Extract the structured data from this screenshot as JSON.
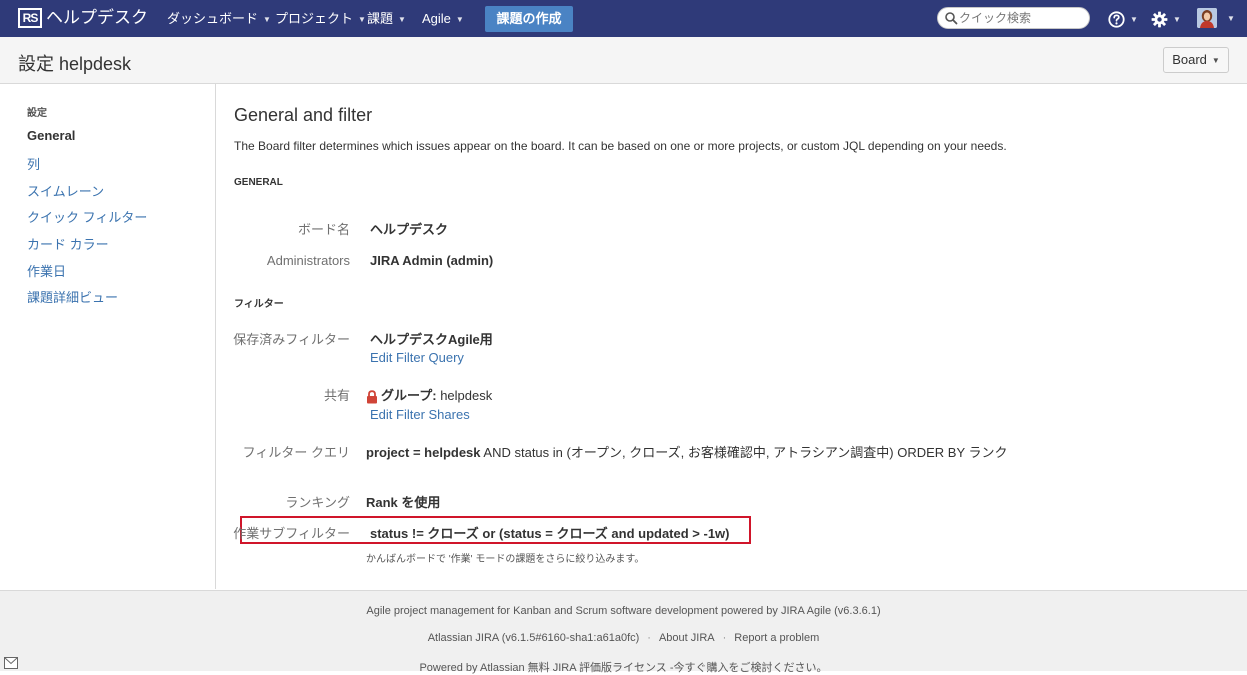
{
  "topnav": {
    "logo_mark": "RS",
    "app_name": "ヘルプデスク",
    "menus": [
      "ダッシュボード",
      "プロジェクト",
      "課題",
      "Agile"
    ],
    "create_label": "課題の作成",
    "search_placeholder": "クイック検索",
    "icons": [
      "help-icon",
      "gear-icon",
      "avatar"
    ]
  },
  "header": {
    "title": "設定 helpdesk",
    "board_button": "Board"
  },
  "sidebar": {
    "heading": "設定",
    "items": [
      "General",
      "列",
      "スイムレーン",
      "クイック フィルター",
      "カード カラー",
      "作業日",
      "課題詳細ビュー"
    ],
    "active_index": 0
  },
  "main": {
    "title": "General and filter",
    "description": "The Board filter determines which issues appear on the board. It can be based on one or more projects, or custom JQL depending on your needs.",
    "general": {
      "heading": "GENERAL",
      "board_name_label": "ボード名",
      "board_name": "ヘルプデスク",
      "admins_label": "Administrators",
      "admins": "JIRA Admin (admin)"
    },
    "filter": {
      "heading": "フィルター",
      "saved_label": "保存済みフィルター",
      "saved_value": "ヘルプデスクAgile用",
      "edit_query_link": "Edit Filter Query",
      "share_label": "共有",
      "share_group_prefix": "グループ:",
      "share_group": "helpdesk",
      "edit_shares_link": "Edit Filter Shares",
      "query_label": "フィルター クエリ",
      "query_project": "project = helpdesk",
      "query_rest": "AND status in (オープン, クローズ, お客様確認中, アトラシアン調査中) ORDER BY ランク",
      "ranking_label": "ランキング",
      "ranking_value": "Rank を使用",
      "subfilter_label": "作業サブフィルター",
      "subfilter_value": "status != クローズ  or (status = クローズ  and updated > -1w)",
      "subfilter_hint": "かんばんボードで '作業' モードの課題をさらに絞り込みます。"
    }
  },
  "footer": {
    "line1": "Agile project management for Kanban and Scrum software development powered by JIRA Agile (v6.3.6.1)",
    "line2_a": "Atlassian JIRA (v6.1.5#6160-sha1:a61a0fc)",
    "line2_b": "About JIRA",
    "line2_c": "Report a problem",
    "line3": "Powered by Atlassian 無料 JIRA 評価版ライセンス -今すぐ購入をご検討ください。"
  },
  "colors": {
    "nav_bg": "#2f3a79",
    "create_button": "#4a83c4",
    "link": "#3b73af",
    "highlight": "#d0152a",
    "lock": "#d04437"
  }
}
